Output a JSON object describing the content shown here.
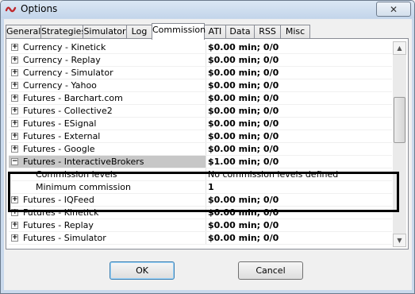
{
  "window": {
    "title": "Options",
    "close_glyph": "✕"
  },
  "tabs": [
    {
      "label": "General",
      "active": false
    },
    {
      "label": "Strategies",
      "active": false
    },
    {
      "label": "Simulator",
      "active": false
    },
    {
      "label": "Log",
      "active": false
    },
    {
      "label": "Commission",
      "active": true
    },
    {
      "label": "ATI",
      "active": false
    },
    {
      "label": "Data",
      "active": false
    },
    {
      "label": "RSS",
      "active": false
    },
    {
      "label": "Misc",
      "active": false
    }
  ],
  "rows": [
    {
      "type": "item",
      "label": "Currency - Kinetick",
      "value": "$0.00 min;  0/0",
      "expanded": false
    },
    {
      "type": "item",
      "label": "Currency - Replay",
      "value": "$0.00 min;  0/0",
      "expanded": false
    },
    {
      "type": "item",
      "label": "Currency - Simulator",
      "value": "$0.00 min;  0/0",
      "expanded": false
    },
    {
      "type": "item",
      "label": "Currency - Yahoo",
      "value": "$0.00 min;  0/0",
      "expanded": false
    },
    {
      "type": "item",
      "label": "Futures - Barchart.com",
      "value": "$0.00 min;  0/0",
      "expanded": false
    },
    {
      "type": "item",
      "label": "Futures - Collective2",
      "value": "$0.00 min;  0/0",
      "expanded": false
    },
    {
      "type": "item",
      "label": "Futures - ESignal",
      "value": "$0.00 min;  0/0",
      "expanded": false
    },
    {
      "type": "item",
      "label": "Futures - External",
      "value": "$0.00 min;  0/0",
      "expanded": false
    },
    {
      "type": "item",
      "label": "Futures - Google",
      "value": "$0.00 min;  0/0",
      "expanded": false
    },
    {
      "type": "item",
      "label": "Futures - InteractiveBrokers",
      "value": "$1.00 min;  0/0",
      "expanded": true,
      "selected": true
    },
    {
      "type": "sub",
      "label": "Commission levels",
      "value": "No commission levels defined",
      "bold": false
    },
    {
      "type": "sub",
      "label": "Minimum commission",
      "value": "1",
      "bold": true
    },
    {
      "type": "item",
      "label": "Futures - IQFeed",
      "value": "$0.00 min;  0/0",
      "expanded": false
    },
    {
      "type": "item",
      "label": "Futures - Kinetick",
      "value": "$0.00 min;  0/0",
      "expanded": false
    },
    {
      "type": "item",
      "label": "Futures - Replay",
      "value": "$0.00 min;  0/0",
      "expanded": false
    },
    {
      "type": "item",
      "label": "Futures - Simulator",
      "value": "$0.00 min;  0/0",
      "expanded": false
    }
  ],
  "buttons": {
    "ok": "OK",
    "cancel": "Cancel"
  },
  "icons": {
    "app": "app-logo-icon",
    "expand": "⊞",
    "collapse": "⊟",
    "scroll_up": "▲",
    "scroll_down": "▼"
  },
  "colors": {
    "selected_row": "#c7c7c7",
    "titlebar": "#c9d9ec",
    "highlight_border": "#000000"
  }
}
